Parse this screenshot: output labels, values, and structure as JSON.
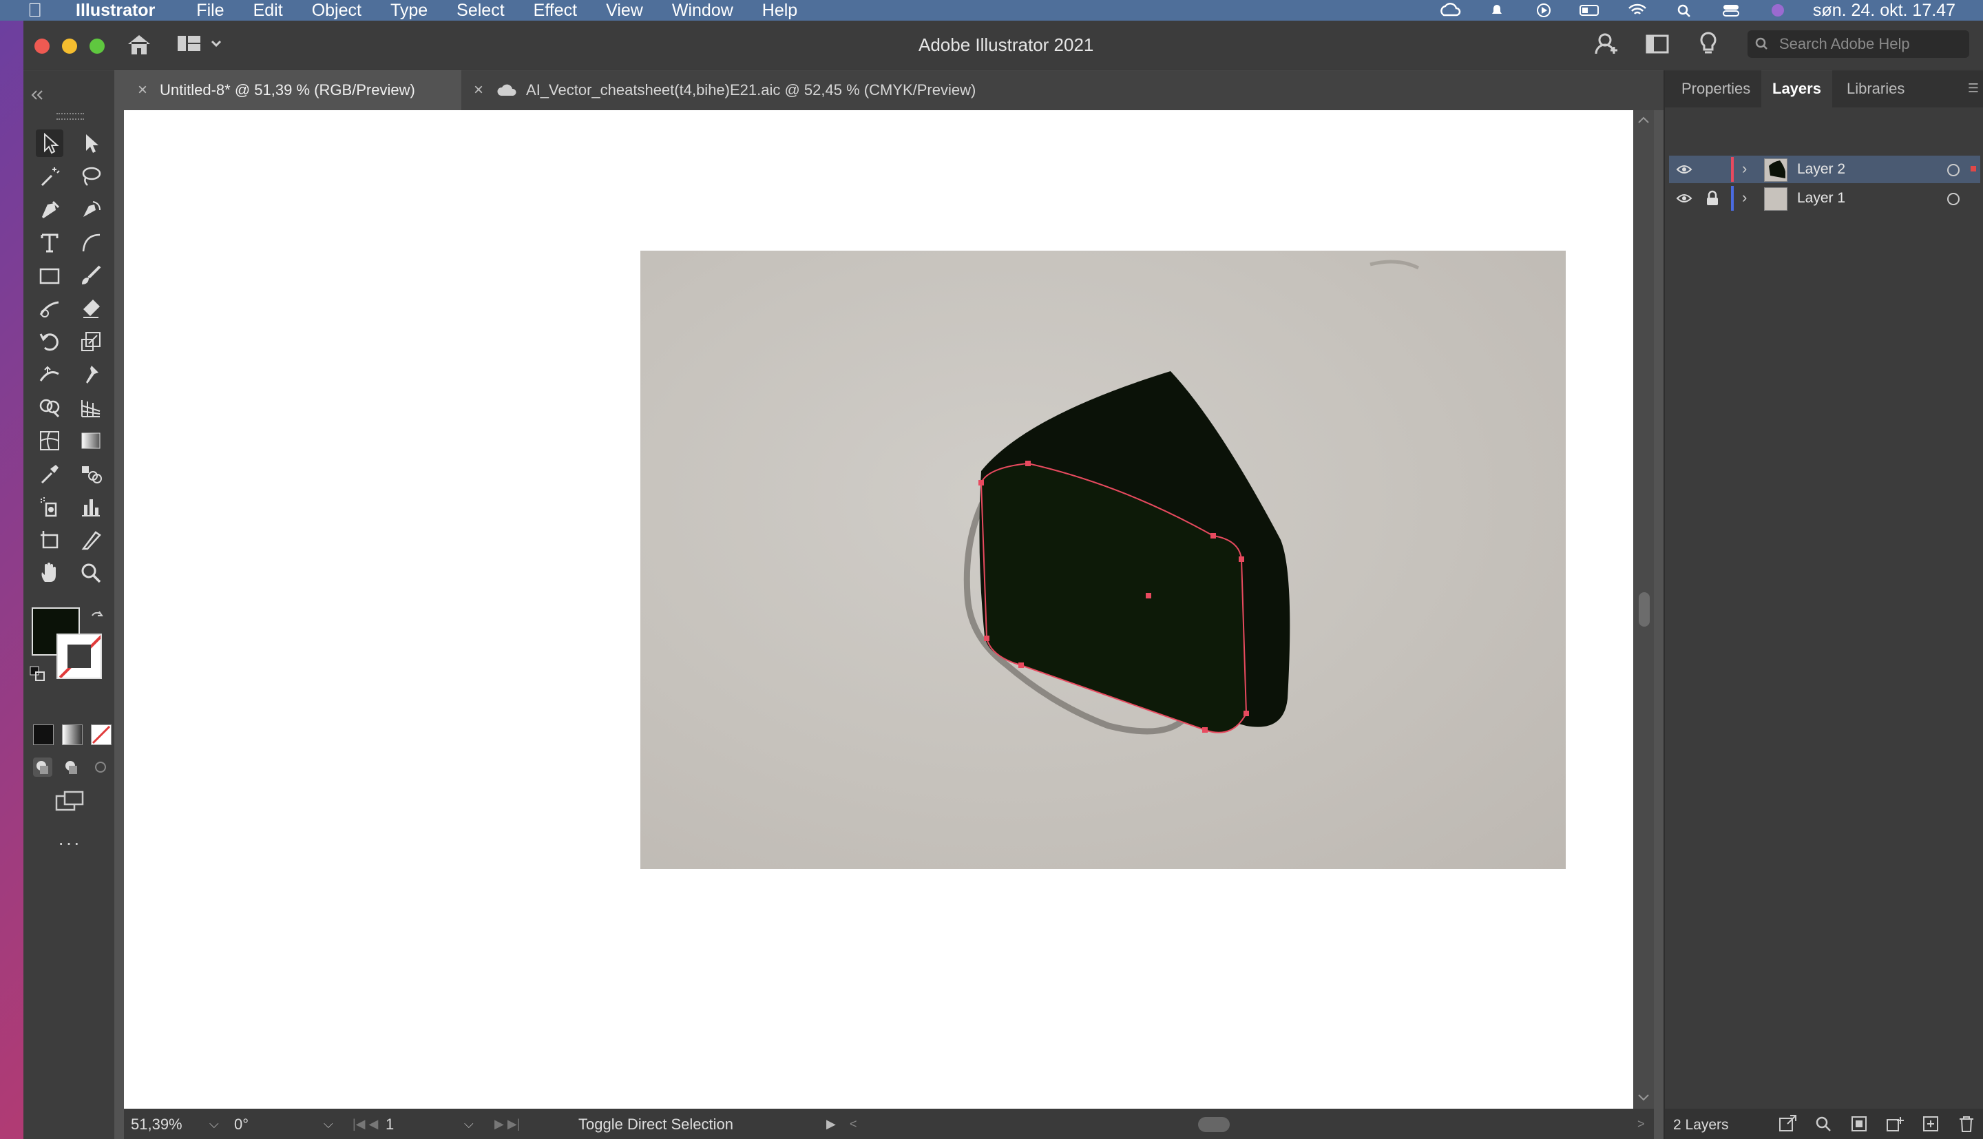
{
  "menubar": {
    "app_name": "Illustrator",
    "items": [
      "File",
      "Edit",
      "Object",
      "Type",
      "Select",
      "Effect",
      "View",
      "Window",
      "Help"
    ],
    "clock": "søn. 24. okt. 17.47"
  },
  "window": {
    "title": "Adobe Illustrator 2021",
    "search_placeholder": "Search Adobe Help"
  },
  "tabs": [
    {
      "label": "Untitled-8* @ 51,39 % (RGB/Preview)",
      "active": true
    },
    {
      "label": "AI_Vector_cheatsheet(t4,bihe)E21.aic @ 52,45 % (CMYK/Preview)",
      "active": false
    }
  ],
  "tools": [
    "selection-tool",
    "direct-selection-tool",
    "magic-wand-tool",
    "lasso-tool",
    "pen-tool",
    "curvature-tool",
    "type-tool",
    "arc-tool",
    "rectangle-tool",
    "paintbrush-tool",
    "shaper-tool",
    "eraser-tool",
    "rotate-tool",
    "scale-tool",
    "width-tool",
    "puppet-warp-tool",
    "shape-builder-tool",
    "perspective-grid-tool",
    "mesh-tool",
    "gradient-tool",
    "eyedropper-tool",
    "blend-tool",
    "symbol-sprayer-tool",
    "column-graph-tool",
    "artboard-tool",
    "slice-tool",
    "hand-tool",
    "zoom-tool"
  ],
  "colors": {
    "fill": "#0b1208",
    "accent": "#4a5a72",
    "anchor": "#e84a5f"
  },
  "status": {
    "zoom": "51,39%",
    "rotation": "0°",
    "artboard": "1",
    "mode": "Toggle Direct Selection"
  },
  "panel": {
    "tabs": [
      "Properties",
      "Layers",
      "Libraries"
    ],
    "active_tab": "Layers",
    "layers": [
      {
        "name": "Layer 2",
        "selected": true,
        "locked": false,
        "color": "#e84a5f"
      },
      {
        "name": "Layer 1",
        "selected": false,
        "locked": true,
        "color": "#4a6be0"
      }
    ],
    "footer": "2 Layers"
  }
}
